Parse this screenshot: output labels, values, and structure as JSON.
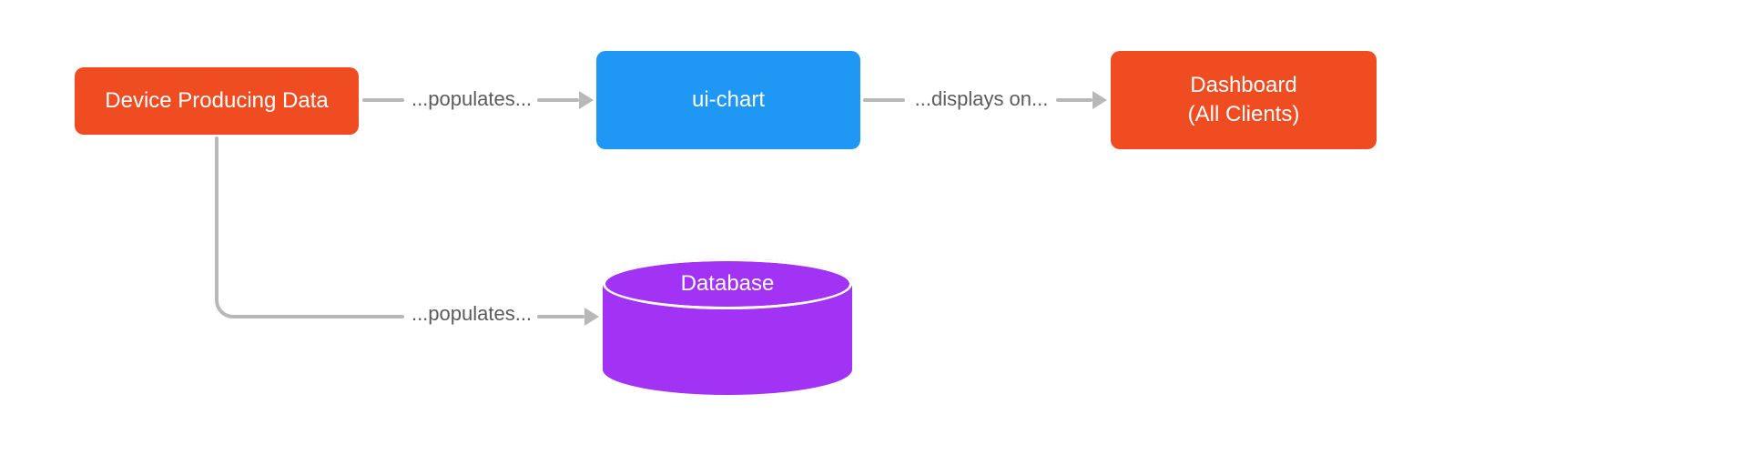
{
  "nodes": {
    "device": {
      "label": "Device Producing Data",
      "color": "#ef4c21"
    },
    "chart": {
      "label": "ui-chart",
      "color": "#1f97f4"
    },
    "dashboard": {
      "label": "Dashboard\n(All Clients)",
      "color": "#ef4c21"
    },
    "database": {
      "label": "Database",
      "color": "#a333f4"
    }
  },
  "edges": {
    "device_to_chart": {
      "label": "...populates..."
    },
    "chart_to_dashboard": {
      "label": "...displays on..."
    },
    "device_to_database": {
      "label": "...populates..."
    }
  },
  "arrow_color": "#b8b8b8"
}
